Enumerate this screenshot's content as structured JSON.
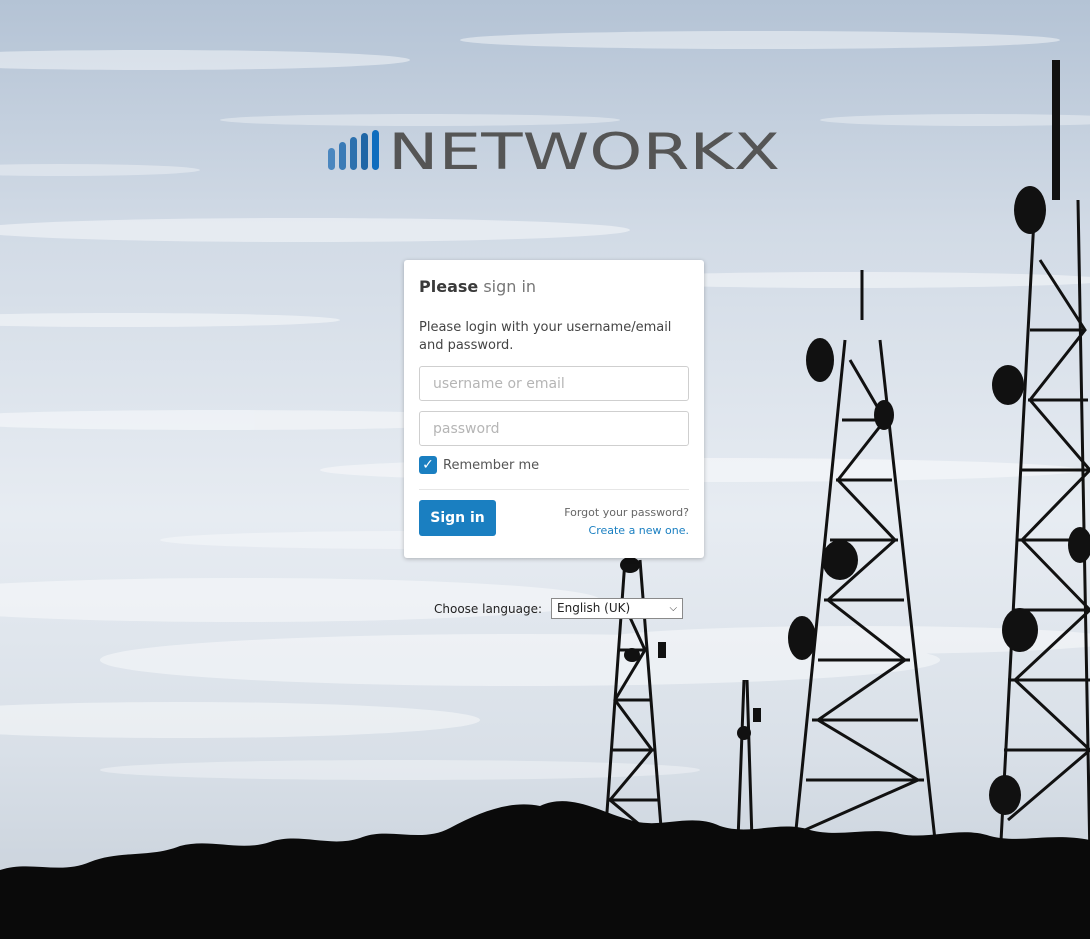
{
  "brand": {
    "name": "NETWORKX",
    "bar_colors": [
      "#3d7ab6",
      "#2e6ea8",
      "#236aa5",
      "#1c5f9a",
      "#0e6dbe"
    ],
    "text_color": "#555555"
  },
  "login": {
    "title_bold": "Please",
    "title_rest": " sign in",
    "intro": "Please login with your username/email and password.",
    "username_placeholder": "username or email",
    "password_placeholder": "password",
    "remember_label": "Remember me",
    "remember_checked": true,
    "signin_label": "Sign in",
    "forgot_text": "Forgot your password?",
    "create_link": "Create a new one."
  },
  "language": {
    "label": "Choose language:",
    "selected": "English (UK)"
  },
  "colors": {
    "accent": "#1a7fc1"
  }
}
